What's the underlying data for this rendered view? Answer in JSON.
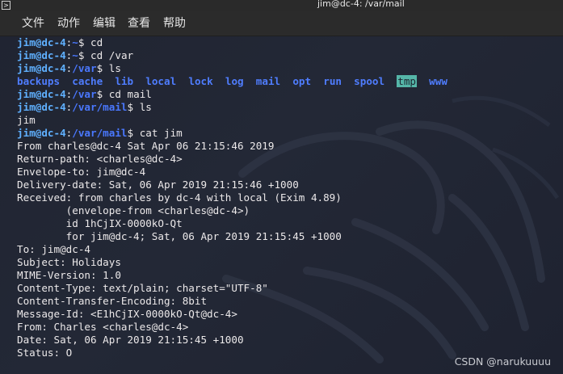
{
  "window": {
    "title": "jim@dc-4: /var/mail",
    "icon": "terminal-icon"
  },
  "menu": [
    "文件",
    "动作",
    "编辑",
    "查看",
    "帮助"
  ],
  "terminal": {
    "prompts": [
      {
        "user": "jim@dc-4",
        "path": "~",
        "cmd": "cd"
      },
      {
        "user": "jim@dc-4",
        "path": "~",
        "cmd": "cd /var"
      },
      {
        "user": "jim@dc-4",
        "path": "/var",
        "cmd": "ls"
      },
      {
        "user": "jim@dc-4",
        "path": "/var",
        "cmd": "cd mail"
      },
      {
        "user": "jim@dc-4",
        "path": "/var/mail",
        "cmd": "ls"
      },
      {
        "user": "jim@dc-4",
        "path": "/var/mail",
        "cmd": "cat jim"
      }
    ],
    "ls_var": [
      "backups",
      "cache",
      "lib",
      "local",
      "lock",
      "log",
      "mail",
      "opt",
      "run",
      "spool",
      "tmp",
      "www"
    ],
    "ls_mail": "jim",
    "mail_lines": [
      "From charles@dc-4 Sat Apr 06 21:15:46 2019",
      "Return-path: <charles@dc-4>",
      "Envelope-to: jim@dc-4",
      "Delivery-date: Sat, 06 Apr 2019 21:15:46 +1000",
      "Received: from charles by dc-4 with local (Exim 4.89)",
      "        (envelope-from <charles@dc-4>)",
      "        id 1hCjIX-0000kO-Qt",
      "        for jim@dc-4; Sat, 06 Apr 2019 21:15:45 +1000",
      "To: jim@dc-4",
      "Subject: Holidays",
      "MIME-Version: 1.0",
      "Content-Type: text/plain; charset=\"UTF-8\"",
      "Content-Transfer-Encoding: 8bit",
      "Message-Id: <E1hCjIX-0000kO-Qt@dc-4>",
      "From: Charles <charles@dc-4>",
      "Date: Sat, 06 Apr 2019 21:15:45 +1000",
      "Status: O"
    ]
  },
  "watermark": "CSDN @narukuuuu",
  "colors": {
    "background": "#222633",
    "user": "#5fb0ff",
    "path": "#4a78ff",
    "text": "#ece9ea",
    "highlight_bg": "#55b6a8"
  }
}
